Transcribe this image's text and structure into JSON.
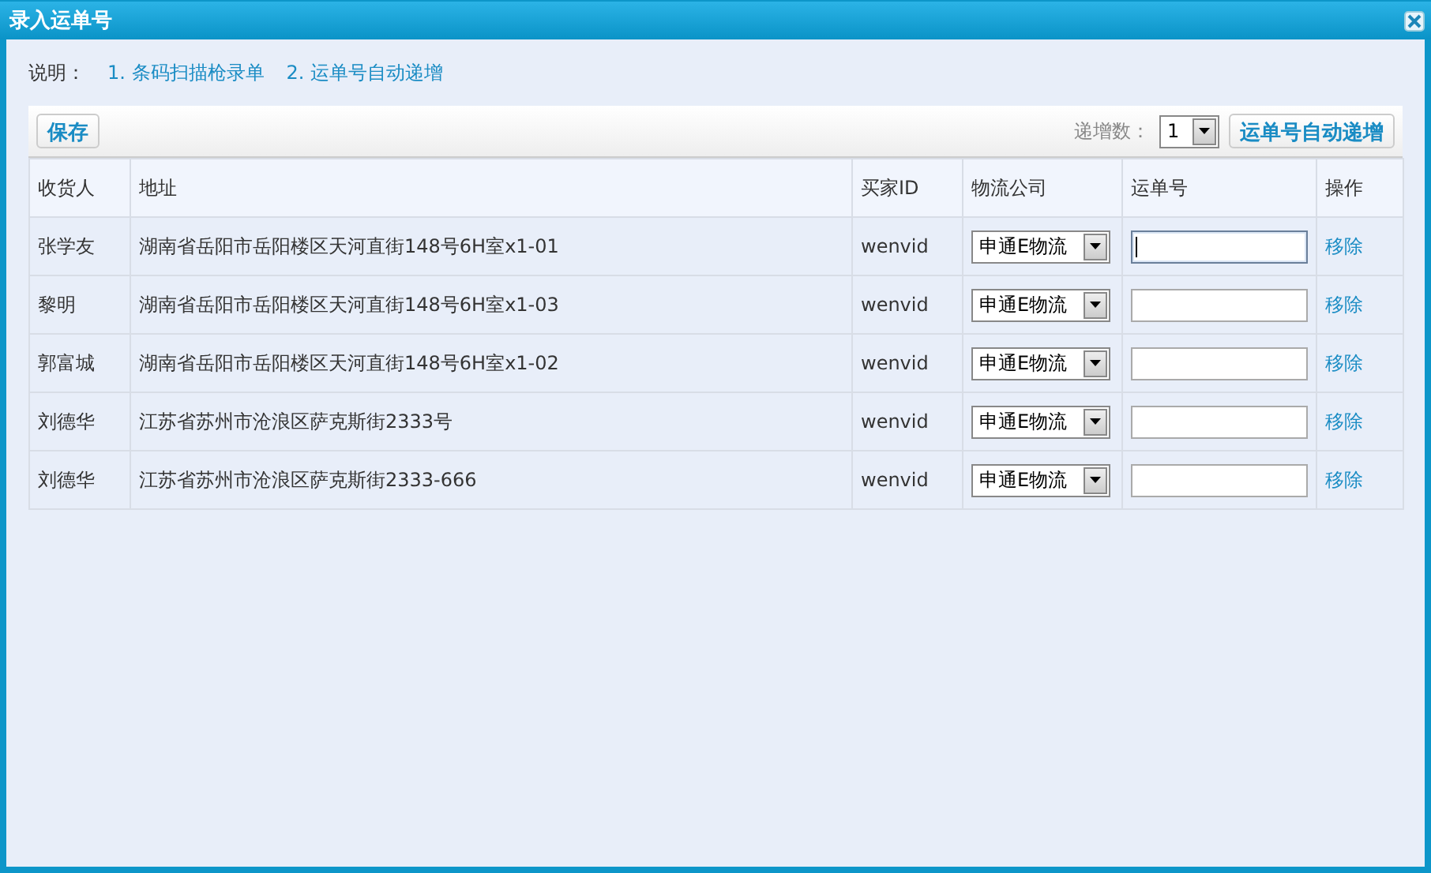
{
  "window": {
    "title": "录入运单号"
  },
  "instructions": {
    "label": "说明：",
    "links": [
      "1. 条码扫描枪录单",
      "2. 运单号自动递增"
    ]
  },
  "toolbar": {
    "save": "保存",
    "step_label": "递增数：",
    "step_value": "1",
    "auto_button": "运单号自动递增"
  },
  "table": {
    "columns": [
      "收货人",
      "地址",
      "买家ID",
      "物流公司",
      "运单号",
      "操作"
    ],
    "rows": [
      {
        "recipient": "张学友",
        "address": "湖南省岳阳市岳阳楼区天河直街148号6H室x1-01",
        "buyer_id": "wenvid",
        "carrier": "申通E物流",
        "focused": true,
        "action": "移除"
      },
      {
        "recipient": "黎明",
        "address": "湖南省岳阳市岳阳楼区天河直街148号6H室x1-03",
        "buyer_id": "wenvid",
        "carrier": "申通E物流",
        "focused": false,
        "action": "移除"
      },
      {
        "recipient": "郭富城",
        "address": "湖南省岳阳市岳阳楼区天河直街148号6H室x1-02",
        "buyer_id": "wenvid",
        "carrier": "申通E物流",
        "focused": false,
        "action": "移除"
      },
      {
        "recipient": "刘德华",
        "address": "江苏省苏州市沧浪区萨克斯街2333号",
        "buyer_id": "wenvid",
        "carrier": "申通E物流",
        "focused": false,
        "action": "移除"
      },
      {
        "recipient": "刘德华",
        "address": "江苏省苏州市沧浪区萨克斯街2333-666",
        "buyer_id": "wenvid",
        "carrier": "申通E物流",
        "focused": false,
        "action": "移除"
      }
    ]
  }
}
